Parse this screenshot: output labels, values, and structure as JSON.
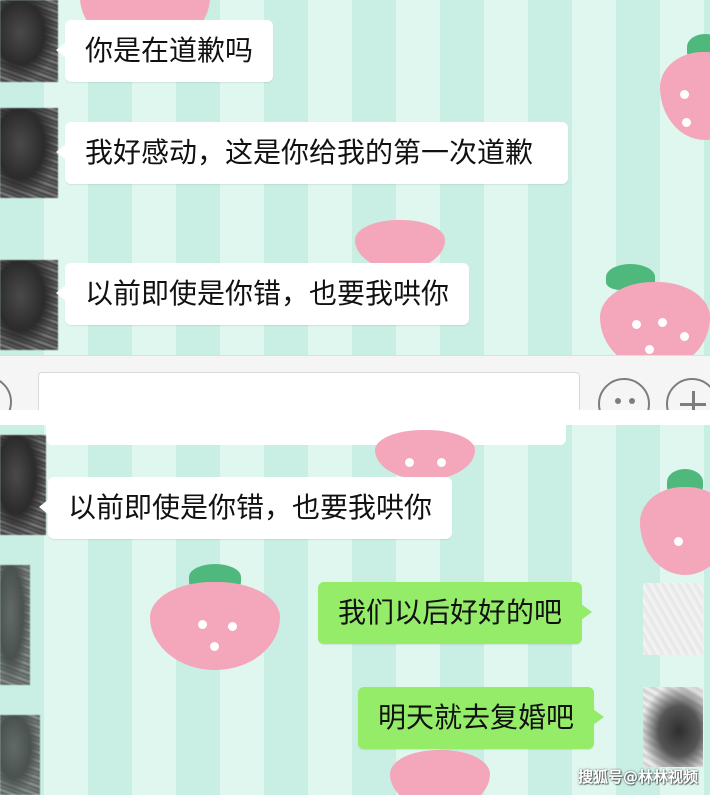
{
  "top_panel": {
    "messages": [
      {
        "side": "left",
        "text": "你是在道歉吗"
      },
      {
        "side": "left",
        "text": "我好感动，这是你给我的第一次道歉"
      },
      {
        "side": "left",
        "text": "以前即使是你错，也要我哄你"
      }
    ]
  },
  "bottom_panel": {
    "messages": [
      {
        "side": "left",
        "text": "以前即使是你错，也要我哄你"
      },
      {
        "side": "right",
        "text": "我们以后好好的吧"
      },
      {
        "side": "right",
        "text": "明天就去复婚吧"
      }
    ]
  },
  "input_bar": {
    "icons": [
      "emoji-icon",
      "plus-icon"
    ]
  },
  "watermark": "搜狐号@林林视频",
  "colors": {
    "chat_bg_stripe_a": "#c9eee4",
    "chat_bg_stripe_b": "#dff7ef",
    "bubble_left": "#ffffff",
    "bubble_right": "#95ec69",
    "strawberry": "#f4a6bb"
  }
}
